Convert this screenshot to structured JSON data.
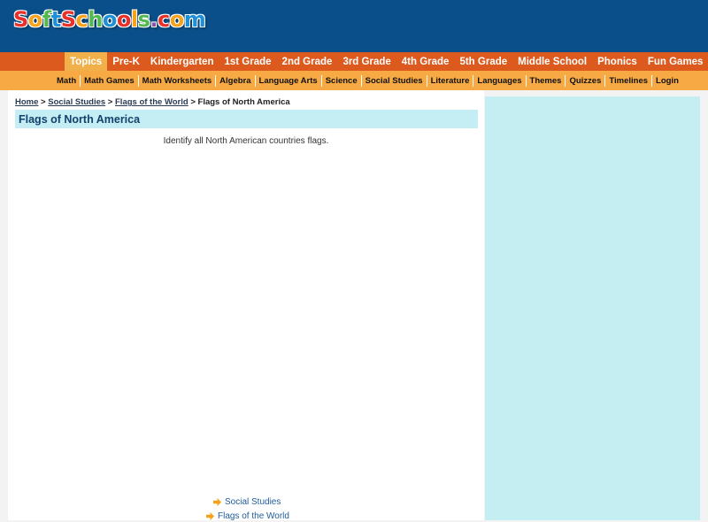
{
  "logo": {
    "letters": [
      "S",
      "o",
      "f",
      "t",
      "S",
      "c",
      "h",
      "o",
      "o",
      "l",
      "s",
      ".",
      "c",
      "o",
      "m"
    ],
    "colors": [
      "#e8312a",
      "#f7a21b",
      "#53b84f",
      "#1e90d8",
      "#e8312a",
      "#f7a21b",
      "#53b84f",
      "#1e90d8",
      "#e8312a",
      "#f7a21b",
      "#53b84f",
      "#8a50a8",
      "#e8312a",
      "#f7a21b",
      "#1e90d8"
    ]
  },
  "nav_primary": {
    "items": [
      "Topics",
      "Pre-K",
      "Kindergarten",
      "1st Grade",
      "2nd Grade",
      "3rd Grade",
      "4th Grade",
      "5th Grade",
      "Middle School",
      "Phonics",
      "Fun Games"
    ],
    "active": "Topics"
  },
  "nav_secondary": {
    "items": [
      "Math",
      "Math Games",
      "Math Worksheets",
      "Algebra",
      "Language Arts",
      "Science",
      "Social Studies",
      "Literature",
      "Languages",
      "Themes",
      "Quizzes",
      "Timelines",
      "Login"
    ]
  },
  "breadcrumb": {
    "home": "Home",
    "sep": " > ",
    "social_studies": "Social Studies",
    "flags_world": "Flags of the World",
    "current": "Flags of North America"
  },
  "page": {
    "title": "Flags of North America",
    "description": "Identify all North American countries flags."
  },
  "related_links": [
    "Social Studies",
    "Flags of the World"
  ],
  "colors": {
    "header": "#0a4f89",
    "nav_primary": "#dd5a1e",
    "nav_secondary": "#f7aa43",
    "title_bar": "#c4eef3",
    "arrow": "#f7a21b"
  }
}
